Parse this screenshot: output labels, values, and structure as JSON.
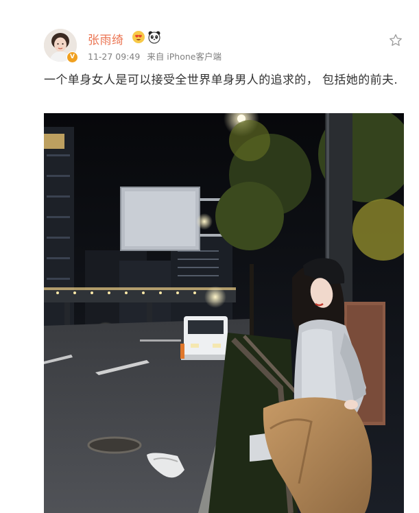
{
  "post": {
    "username": "张雨绮",
    "badges": [
      "love-heart-emoji-icon",
      "panda-emoji-icon"
    ],
    "verified_mark": "V",
    "timestamp": "11-27 09:49",
    "source": "来自 iPhone客户端",
    "text": "一个单身女人是可以接受全世界单身男人的追求的， 包括她的前夫.",
    "colors": {
      "username": "#eb7350",
      "meta": "#808080",
      "body_text": "#333333",
      "verified": "#f0a020"
    }
  },
  "photo": {
    "subject": "night-street-photo"
  }
}
